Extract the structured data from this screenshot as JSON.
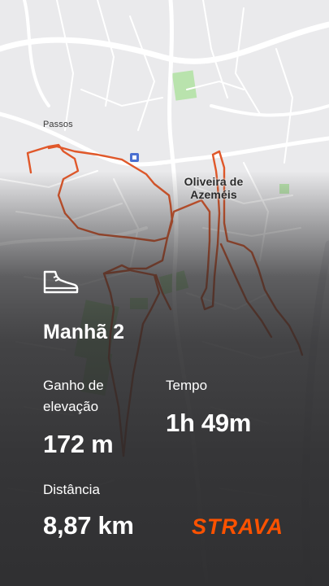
{
  "map": {
    "labels": {
      "passos": "Passos",
      "city": "Oliveira de Azeméis"
    },
    "route_color": "#e0582a",
    "park_color": "#8ccf7e"
  },
  "activity": {
    "icon": "hiking-boot-icon",
    "title": "Manhã 2"
  },
  "stats": {
    "elevation_label": "Ganho de elevação",
    "elevation_value": "172 m",
    "time_label": "Tempo",
    "time_value": "1h 49m",
    "distance_label": "Distância",
    "distance_value": "8,87 km"
  },
  "brand": {
    "name": "STRAVA",
    "color": "#fc5200"
  }
}
